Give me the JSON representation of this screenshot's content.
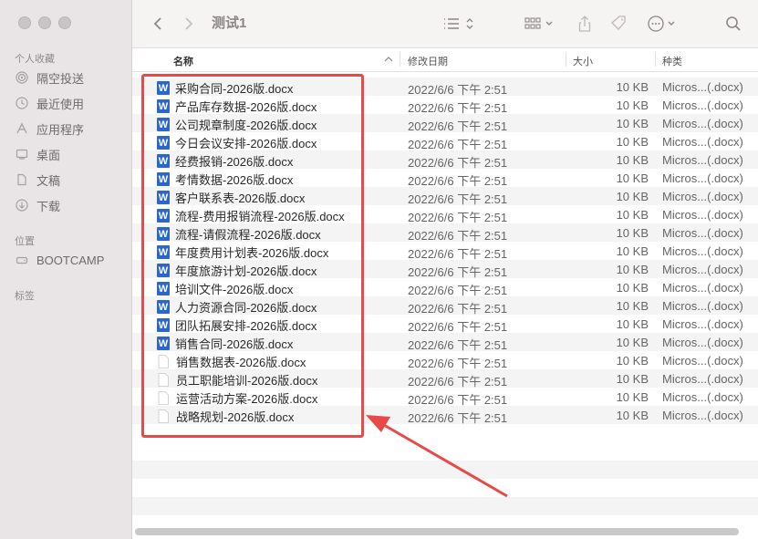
{
  "window": {
    "title": "测试1"
  },
  "sidebar": {
    "favorites_title": "个人收藏",
    "favorites": [
      {
        "label": "隔空投送",
        "icon": "airdrop-icon"
      },
      {
        "label": "最近使用",
        "icon": "clock-icon"
      },
      {
        "label": "应用程序",
        "icon": "applications-icon"
      },
      {
        "label": "桌面",
        "icon": "desktop-icon"
      },
      {
        "label": "文稿",
        "icon": "document-icon"
      },
      {
        "label": "下载",
        "icon": "download-icon"
      }
    ],
    "locations_title": "位置",
    "locations": [
      {
        "label": "BOOTCAMP",
        "icon": "drive-icon"
      }
    ],
    "tags_title": "标签"
  },
  "columns": {
    "name": "名称",
    "date": "修改日期",
    "size": "大小",
    "kind": "种类"
  },
  "files": [
    {
      "name": "采购合同-2026版.docx",
      "date": "2022/6/6 下午 2:51",
      "size": "10 KB",
      "kind": "Micros...(.docx)",
      "icon": "word"
    },
    {
      "name": "产品库存数据-2026版.docx",
      "date": "2022/6/6 下午 2:51",
      "size": "10 KB",
      "kind": "Micros...(.docx)",
      "icon": "word"
    },
    {
      "name": "公司规章制度-2026版.docx",
      "date": "2022/6/6 下午 2:51",
      "size": "10 KB",
      "kind": "Micros...(.docx)",
      "icon": "word"
    },
    {
      "name": "今日会议安排-2026版.docx",
      "date": "2022/6/6 下午 2:51",
      "size": "10 KB",
      "kind": "Micros...(.docx)",
      "icon": "word"
    },
    {
      "name": "经费报销-2026版.docx",
      "date": "2022/6/6 下午 2:51",
      "size": "10 KB",
      "kind": "Micros...(.docx)",
      "icon": "word"
    },
    {
      "name": "考情数据-2026版.docx",
      "date": "2022/6/6 下午 2:51",
      "size": "10 KB",
      "kind": "Micros...(.docx)",
      "icon": "word"
    },
    {
      "name": "客户联系表-2026版.docx",
      "date": "2022/6/6 下午 2:51",
      "size": "10 KB",
      "kind": "Micros...(.docx)",
      "icon": "word"
    },
    {
      "name": "流程-费用报销流程-2026版.docx",
      "date": "2022/6/6 下午 2:51",
      "size": "10 KB",
      "kind": "Micros...(.docx)",
      "icon": "word"
    },
    {
      "name": "流程-请假流程-2026版.docx",
      "date": "2022/6/6 下午 2:51",
      "size": "10 KB",
      "kind": "Micros...(.docx)",
      "icon": "word"
    },
    {
      "name": "年度费用计划表-2026版.docx",
      "date": "2022/6/6 下午 2:51",
      "size": "10 KB",
      "kind": "Micros...(.docx)",
      "icon": "word"
    },
    {
      "name": "年度旅游计划-2026版.docx",
      "date": "2022/6/6 下午 2:51",
      "size": "10 KB",
      "kind": "Micros...(.docx)",
      "icon": "word"
    },
    {
      "name": "培训文件-2026版.docx",
      "date": "2022/6/6 下午 2:51",
      "size": "10 KB",
      "kind": "Micros...(.docx)",
      "icon": "word"
    },
    {
      "name": "人力资源合同-2026版.docx",
      "date": "2022/6/6 下午 2:51",
      "size": "10 KB",
      "kind": "Micros...(.docx)",
      "icon": "word"
    },
    {
      "name": "团队拓展安排-2026版.docx",
      "date": "2022/6/6 下午 2:51",
      "size": "10 KB",
      "kind": "Micros...(.docx)",
      "icon": "word"
    },
    {
      "name": "销售合同-2026版.docx",
      "date": "2022/6/6 下午 2:51",
      "size": "10 KB",
      "kind": "Micros...(.docx)",
      "icon": "word"
    },
    {
      "name": "销售数据表-2026版.docx",
      "date": "2022/6/6 下午 2:51",
      "size": "10 KB",
      "kind": "Micros...(.docx)",
      "icon": "doc"
    },
    {
      "name": "员工职能培训-2026版.docx",
      "date": "2022/6/6 下午 2:51",
      "size": "10 KB",
      "kind": "Micros...(.docx)",
      "icon": "doc"
    },
    {
      "name": "运营活动方案-2026版.docx",
      "date": "2022/6/6 下午 2:51",
      "size": "10 KB",
      "kind": "Micros...(.docx)",
      "icon": "doc"
    },
    {
      "name": "战略规划-2026版.docx",
      "date": "2022/6/6 下午 2:51",
      "size": "10 KB",
      "kind": "Micros...(.docx)",
      "icon": "doc"
    }
  ],
  "colors": {
    "highlight": "#e84a4a",
    "word_blue": "#2b67c9"
  }
}
